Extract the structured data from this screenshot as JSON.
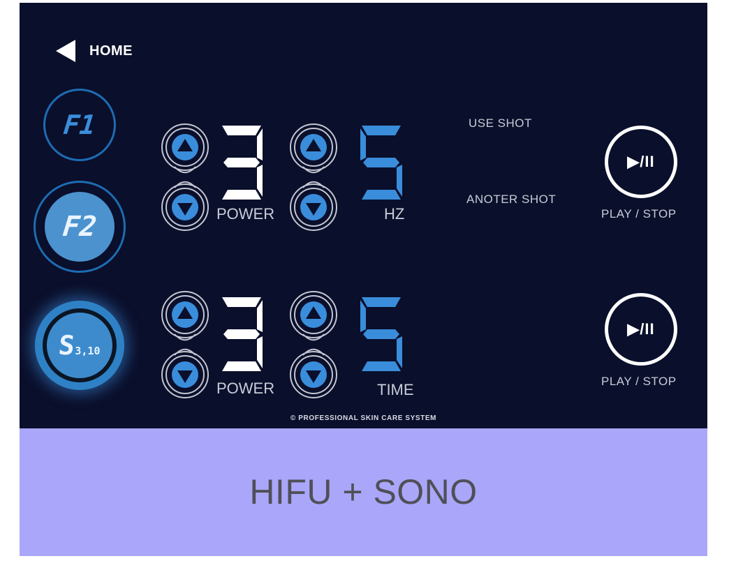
{
  "colors": {
    "panel_background": "#0a0f2b",
    "accent_blue": "#3a8ddb",
    "active_mode": "#4b92cf",
    "caption_band": "#aaa6f9",
    "caption_text": "#4f5057"
  },
  "nav": {
    "home_label": "HOME",
    "home_icon": "back-arrow-icon"
  },
  "modes": [
    {
      "id": "f1",
      "label": "F1",
      "state": "inactive"
    },
    {
      "id": "f2",
      "label": "F2",
      "state": "selected"
    },
    {
      "id": "s",
      "label": "S",
      "sub": "3,10",
      "state": "glowing"
    }
  ],
  "rows": [
    {
      "power_value": "3",
      "power_label": "POWER",
      "second_value": "5",
      "second_label": "HZ"
    },
    {
      "power_value": "3",
      "power_label": "POWER",
      "second_value": "5",
      "second_label": "TIME"
    }
  ],
  "counters": {
    "use_shot_label": "USE  SHOT",
    "another_shot_label": "ANOTER SHOT"
  },
  "play": {
    "glyph": "▶/II",
    "label": "PLAY / STOP"
  },
  "footer": "© PROFESSIONAL SKIN CARE SYSTEM",
  "caption": "HIFU + SONO"
}
